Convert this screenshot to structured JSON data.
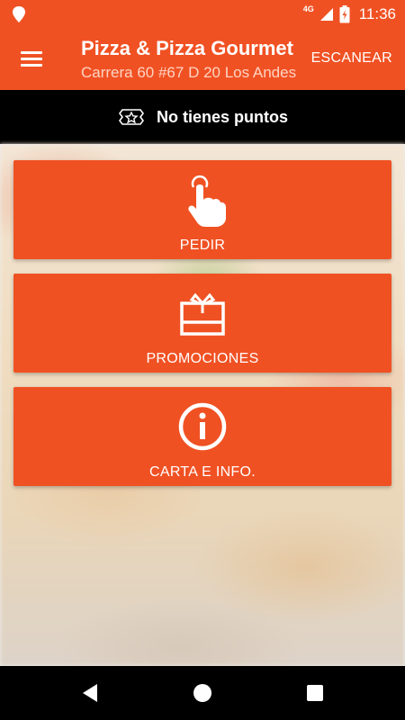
{
  "status_bar": {
    "network": "4G",
    "time": "11:36"
  },
  "app_bar": {
    "title": "Pizza & Pizza Gourmet",
    "subtitle": "Carrera 60  #67 D 20 Los Andes",
    "scan_label": "ESCANEAR"
  },
  "points": {
    "label": "No tienes puntos",
    "icon": "star-badge-icon"
  },
  "actions": [
    {
      "label": "PEDIR",
      "icon": "tap-finger-icon"
    },
    {
      "label": "PROMOCIONES",
      "icon": "gift-icon"
    },
    {
      "label": "CARTA E INFO.",
      "icon": "info-icon"
    }
  ],
  "colors": {
    "accent": "#f05123",
    "strip": "#000000"
  }
}
